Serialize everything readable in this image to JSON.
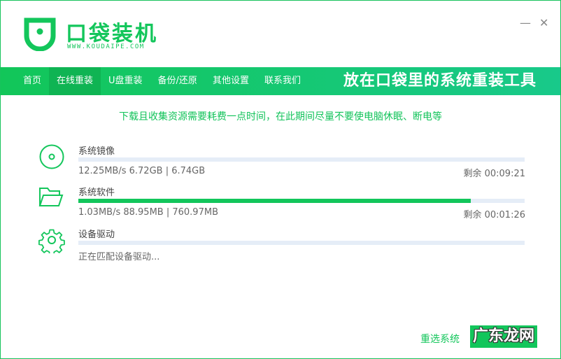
{
  "app": {
    "title": "口袋装机",
    "url": "WWW.KOUDAIPE.COM"
  },
  "window": {
    "minimize": "—",
    "close": "✕"
  },
  "nav": {
    "items": [
      {
        "label": "首页"
      },
      {
        "label": "在线重装",
        "active": true
      },
      {
        "label": "U盘重装"
      },
      {
        "label": "备份/还原"
      },
      {
        "label": "其他设置"
      },
      {
        "label": "联系我们"
      }
    ],
    "slogan": "放在口袋里的系统重装工具"
  },
  "notice": "下载且收集资源需要耗费一点时间，在此期间尽量不要使电脑休眠、断电等",
  "tasks": [
    {
      "icon": "disc-icon",
      "name": "系统镜像",
      "info": "12.25MB/s 6.72GB | 6.74GB",
      "remain": "剩余 00:09:21",
      "progress": 0
    },
    {
      "icon": "folder-icon",
      "name": "系统软件",
      "info": "1.03MB/s 88.95MB | 760.97MB",
      "remain": "剩余 00:01:26",
      "progress": 88
    },
    {
      "icon": "gear-icon",
      "name": "设备驱动",
      "info": "正在匹配设备驱动...",
      "remain": "",
      "progress": 0
    }
  ],
  "footer": {
    "reselect": "重选系统",
    "watermark": "广东龙网"
  },
  "colors": {
    "accent": "#12c65b",
    "track": "#e5edf7"
  }
}
